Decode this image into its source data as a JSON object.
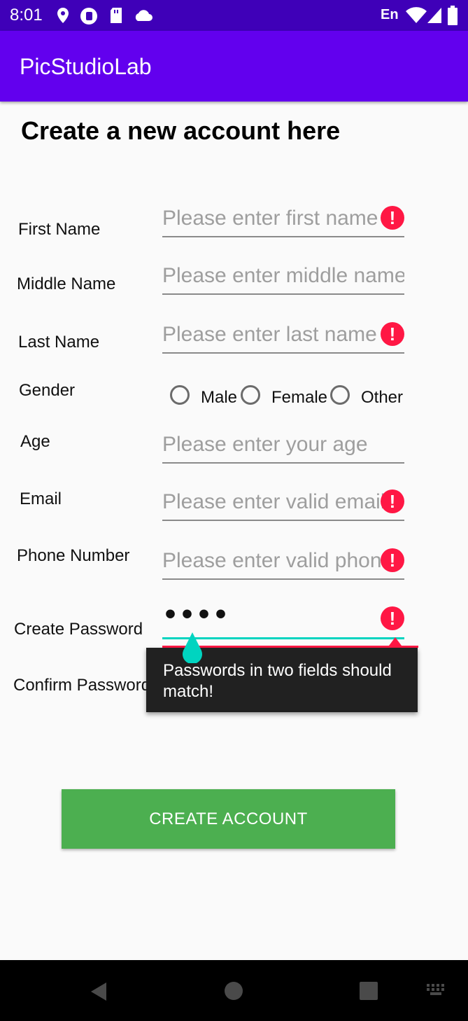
{
  "status_bar": {
    "time": "8:01",
    "keyboard_lang": "En",
    "icons": [
      "location-icon",
      "screen-record-icon",
      "sd-card-icon",
      "cloud-icon",
      "wifi-icon",
      "signal-icon",
      "battery-icon"
    ]
  },
  "app_bar": {
    "title": "PicStudioLab"
  },
  "form": {
    "heading": "Create a new account here",
    "first_name": {
      "label": "First Name",
      "placeholder": "Please enter first name",
      "error": true
    },
    "middle_name": {
      "label": "Middle Name",
      "placeholder": "Please enter middle name",
      "error": false
    },
    "last_name": {
      "label": "Last Name",
      "placeholder": "Please enter last name",
      "error": true
    },
    "gender": {
      "label": "Gender",
      "options": [
        "Male",
        "Female",
        "Other"
      ]
    },
    "age": {
      "label": "Age",
      "placeholder": "Please enter your age",
      "error": false
    },
    "email": {
      "label": "Email",
      "placeholder": "Please enter valid email",
      "error": true
    },
    "phone": {
      "label": "Phone Number",
      "placeholder": "Please enter valid phone",
      "error": true
    },
    "create_password": {
      "label": "Create Password",
      "value": "••••",
      "error": true
    },
    "confirm_password": {
      "label": "Confirm Password",
      "error": true
    },
    "error_tooltip": "Passwords in two fields should match!",
    "submit_label": "CREATE ACCOUNT",
    "error_symbol": "!"
  },
  "colors": {
    "status_bar": "#3f00b8",
    "app_bar": "#6200ee",
    "button": "#4caf50",
    "error": "#ff1744",
    "focus": "#00d4c0"
  },
  "nav_bar": {
    "icons": [
      "back-icon",
      "home-icon",
      "recents-icon",
      "keyboard-icon"
    ]
  }
}
